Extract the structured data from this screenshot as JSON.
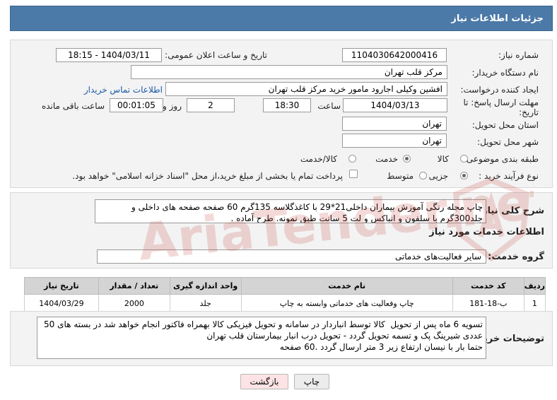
{
  "header": {
    "title": "جزئیات اطلاعات نیاز"
  },
  "need": {
    "number_label": "شماره نیاز:",
    "number_value": "1104030642000416",
    "announce_label": "تاریخ و ساعت اعلان عمومی:",
    "announce_value": "1404/03/11 - 18:15",
    "buyer_label": "نام دستگاه خریدار:",
    "buyer_value": "مرکز قلب تهران",
    "creator_label": "ایجاد کننده درخواست:",
    "creator_value": "افشین وکیلی اجارود مامور خرید مرکز قلب تهران",
    "contact_link": "اطلاعات تماس خریدار",
    "deadline_label_1": "مهلت ارسال پاسخ: تا",
    "deadline_label_2": "تاریخ:",
    "deadline_date": "1404/03/13",
    "time_label": "ساعت",
    "deadline_time": "18:30",
    "days_value": "2",
    "days_label": "روز و",
    "remaining_value": "00:01:05",
    "remaining_label": "ساعت باقی مانده",
    "province_label": "استان محل تحویل:",
    "province_value": "تهران",
    "city_label": "شهر محل تحویل:",
    "city_value": "تهران",
    "category_label": "طبقه بندی موضوعی:",
    "category_options": [
      "کالا",
      "خدمت",
      "کالا/خدمت"
    ],
    "category_selected": "خدمت",
    "process_label": "نوع فرآیند خرید :",
    "process_options": [
      "جزیی",
      "متوسط"
    ],
    "process_selected": "جزیی",
    "payment_note": "پرداخت تمام یا بخشی از مبلغ خرید،از محل \"اسناد خزانه اسلامی\" خواهد بود."
  },
  "summary": {
    "label": "شرح کلی نیاز:",
    "text": "چاپ مجله رنگی آموزش بیماران داخلی21*29 با کاغذگلاسه 135گرم  60 صفحه صفحه های داخلی و جلد300گرم با سلفون و انباکس و لت 5 سانت طبق نمونه. طرح آماده ."
  },
  "services": {
    "section_title": "اطلاعات خدمات مورد نیاز",
    "group_label": "گروه خدمت:",
    "group_value": "سایر فعالیت‌های خدماتی",
    "columns": [
      "ردیف",
      "کد خدمت",
      "نام خدمت",
      "واحد اندازه گیری",
      "تعداد / مقدار",
      "تاریخ نیاز"
    ],
    "rows": [
      {
        "row": "1",
        "code": "ب-18-181",
        "name": "چاپ وفعالیت های خدماتی وابسته به چاپ",
        "unit": "جلد",
        "qty": "2000",
        "date": "1404/03/29"
      }
    ]
  },
  "buyer_notes": {
    "label": "توضیحات خریدار:",
    "text": "تسویه 6 ماه پس از تحویل  کالا توسط انباردار در سامانه و تحویل فیزیکی کالا بهمراه فاکتور انجام خواهد شد در بسته های 50 عددی شیرینگ پک و تسمه تحویل گردد - تحویل درب انبار بیمارستان قلب تهران\nحتما بار با نیسان ارتفاع زیر 3 متر ارسال گردد .60 صفحه"
  },
  "buttons": {
    "print": "چاپ",
    "back": "بازگشت"
  },
  "watermark": {
    "text": "AriaTender.net"
  },
  "colors": {
    "header": "#4b79a8",
    "panel": "#f3f3f3",
    "link": "#1a5aa8",
    "back_button": "#fde3e3",
    "watermark": "#c0392b"
  },
  "icons": {
    "watermark_logo": "aria-tender-logo"
  }
}
